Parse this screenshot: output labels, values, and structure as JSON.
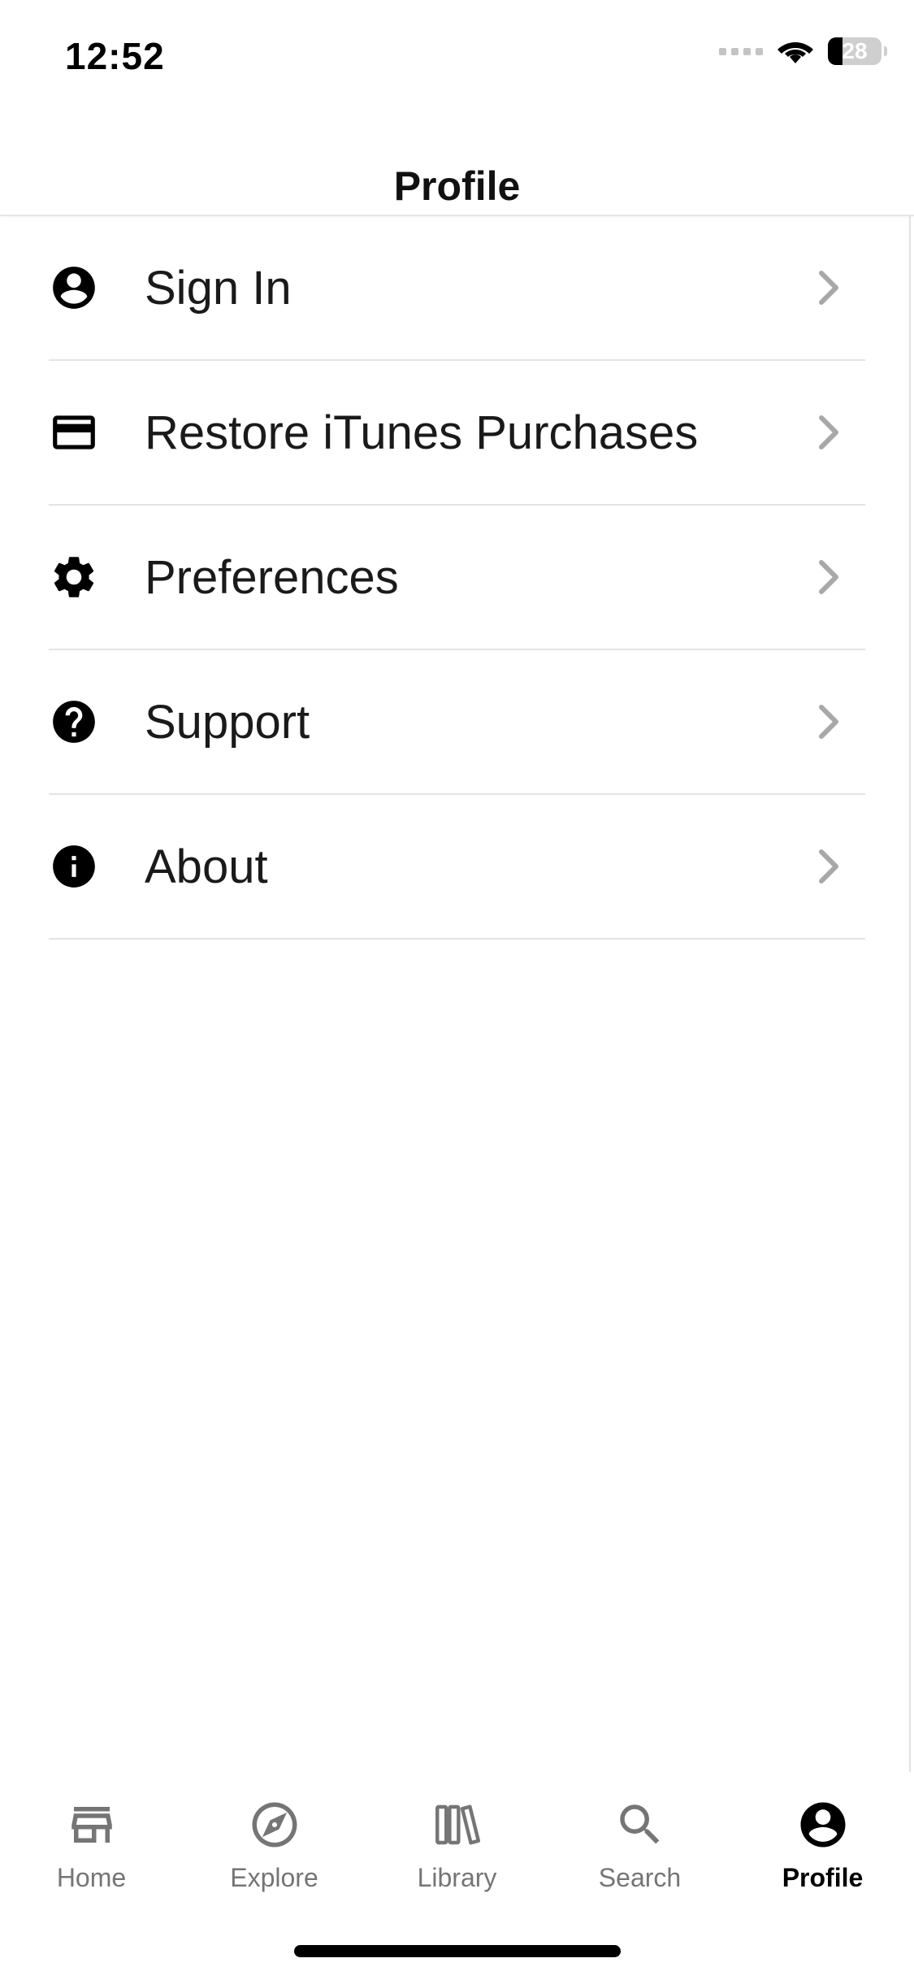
{
  "status_bar": {
    "time": "12:52",
    "battery_level": "28"
  },
  "header": {
    "title": "Profile"
  },
  "menu": [
    {
      "label": "Sign In",
      "icon": "account-circle-icon"
    },
    {
      "label": "Restore iTunes Purchases",
      "icon": "credit-card-icon"
    },
    {
      "label": "Preferences",
      "icon": "gear-icon"
    },
    {
      "label": "Support",
      "icon": "help-circle-icon"
    },
    {
      "label": "About",
      "icon": "info-circle-icon"
    }
  ],
  "tabs": [
    {
      "label": "Home",
      "icon": "store-icon",
      "active": false
    },
    {
      "label": "Explore",
      "icon": "compass-icon",
      "active": false
    },
    {
      "label": "Library",
      "icon": "library-books-icon",
      "active": false
    },
    {
      "label": "Search",
      "icon": "search-icon",
      "active": false
    },
    {
      "label": "Profile",
      "icon": "account-circle-icon",
      "active": true
    }
  ],
  "colors": {
    "text": "#1a1a1a",
    "divider": "#e4e4e4",
    "chevron": "#a8a8a8",
    "tab_inactive": "#757575",
    "tab_active": "#000000"
  }
}
